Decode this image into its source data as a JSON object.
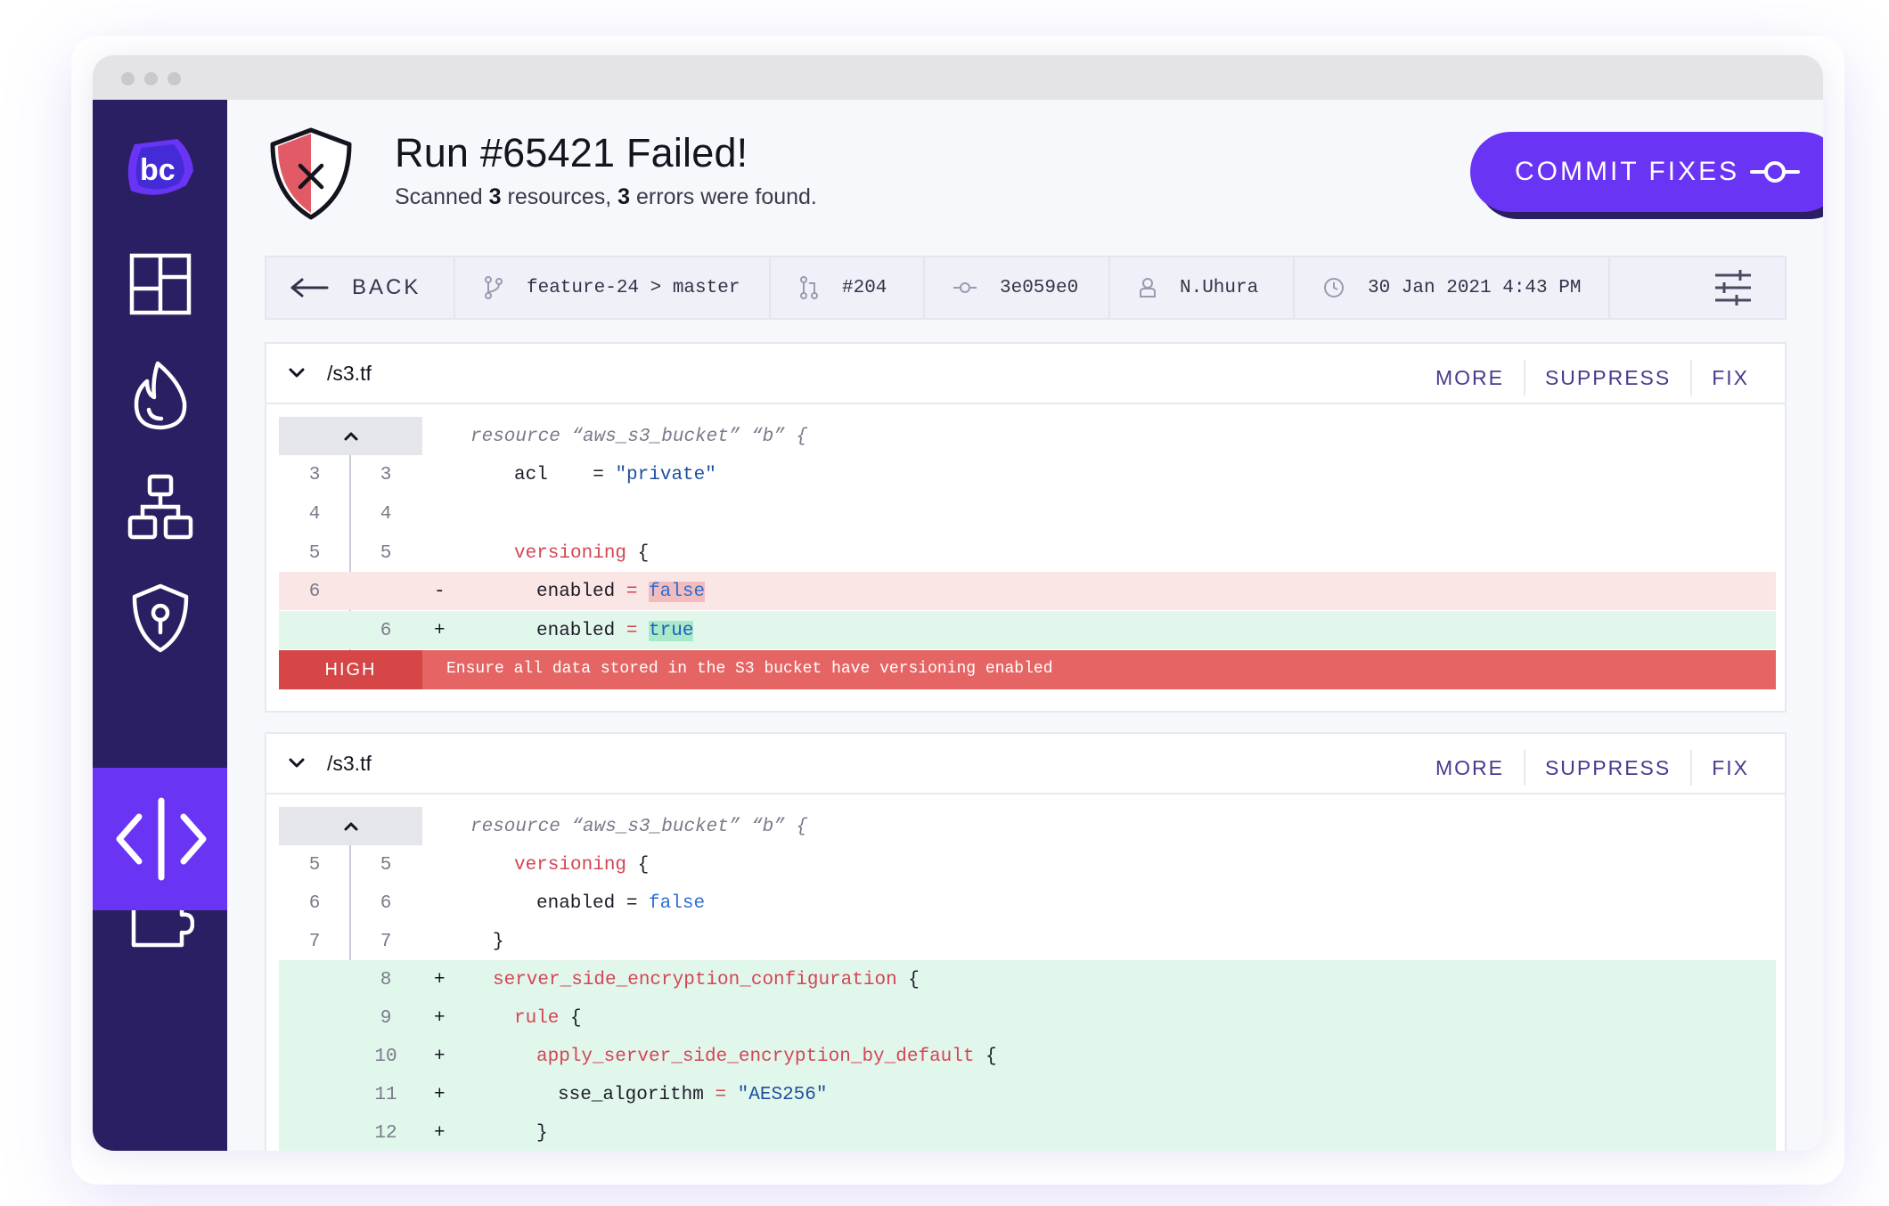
{
  "header": {
    "title": "Run #65421 Failed!",
    "subtitle_prefix": "Scanned ",
    "resources_count": "3",
    "subtitle_mid": " resources, ",
    "errors_count": "3",
    "subtitle_suffix": " errors were found.",
    "commit_label": "COMMIT FIXES"
  },
  "sidebar": {
    "logo_text": "bc",
    "items": [
      "dashboard-icon",
      "incidents-icon",
      "resources-icon",
      "policies-icon",
      "code-review-icon",
      "integrations-icon"
    ],
    "active": "code-review-icon",
    "colors": {
      "background": "#2a1f63",
      "accent": "#6a34f5"
    }
  },
  "meta": {
    "back_label": "BACK",
    "branch": "feature-24 > master",
    "pr": "#204",
    "commit": "3e059e0",
    "author": "N.Uhura",
    "datetime": "30 Jan 2021 4:43 PM"
  },
  "panels": [
    {
      "file": "/s3.tf",
      "actions": [
        "MORE",
        "SUPPRESS",
        "FIX"
      ],
      "context_line": "resource “aws_s3_bucket” “b” {",
      "lines": [
        {
          "old": "3",
          "new": "3",
          "marker": "",
          "key": "acl",
          "op": "    =",
          "value": "\"private\"",
          "type": "context"
        },
        {
          "old": "4",
          "new": "4",
          "marker": "",
          "type": "context"
        },
        {
          "old": "5",
          "new": "5",
          "marker": "",
          "key": "versioning",
          "op": "{",
          "type": "context"
        },
        {
          "old": "6",
          "new": "",
          "marker": "-",
          "key": "enabled",
          "op": "=",
          "value": "false",
          "type": "del"
        },
        {
          "old": "",
          "new": "6",
          "marker": "+",
          "key": "enabled",
          "op": "=",
          "value": "true",
          "type": "add"
        }
      ],
      "severity": "HIGH",
      "message": "Ensure all data stored in the S3 bucket have versioning enabled"
    },
    {
      "file": "/s3.tf",
      "actions": [
        "MORE",
        "SUPPRESS",
        "FIX"
      ],
      "context_line": "resource “aws_s3_bucket” “b” {",
      "lines": [
        {
          "old": "5",
          "new": "5",
          "marker": "",
          "key": "versioning",
          "op": "{",
          "type": "context"
        },
        {
          "old": "6",
          "new": "6",
          "marker": "",
          "key": "enabled",
          "op": "=",
          "value": "false",
          "type": "context"
        },
        {
          "old": "7",
          "new": "7",
          "marker": "",
          "key": "}",
          "type": "context"
        },
        {
          "old": "",
          "new": "8",
          "marker": "+",
          "key": "server_side_encryption_configuration",
          "op": "{",
          "type": "add"
        },
        {
          "old": "",
          "new": "9",
          "marker": "+",
          "key": "rule",
          "op": "{",
          "type": "add"
        },
        {
          "old": "",
          "new": "10",
          "marker": "+",
          "key": "apply_server_side_encryption_by_default",
          "op": "{",
          "type": "add"
        },
        {
          "old": "",
          "new": "11",
          "marker": "+",
          "key": "sse_algorithm",
          "op": "=",
          "value": "\"AES256\"",
          "type": "add"
        },
        {
          "old": "",
          "new": "12",
          "marker": "+",
          "key": "}",
          "type": "add"
        }
      ]
    }
  ]
}
